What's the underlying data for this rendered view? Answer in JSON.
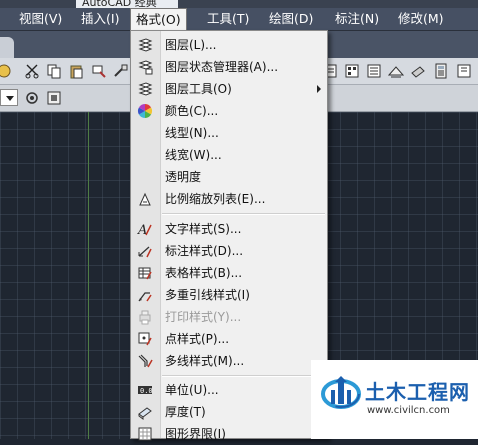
{
  "window": {
    "title_tab": "AutoCAD 经典"
  },
  "menubar": {
    "items": [
      {
        "label": "视图(V)"
      },
      {
        "label": "插入(I)"
      },
      {
        "label": "格式(O)"
      },
      {
        "label": "工具(T)"
      },
      {
        "label": "绘图(D)"
      },
      {
        "label": "标注(N)"
      },
      {
        "label": "修改(M)"
      }
    ]
  },
  "format_menu": {
    "items": [
      {
        "label": "图层(L)...",
        "icon": "layer-icon"
      },
      {
        "label": "图层状态管理器(A)...",
        "icon": "layer-state-icon"
      },
      {
        "label": "图层工具(O)",
        "icon": "layer-tools-icon",
        "submenu": true
      },
      {
        "label": "颜色(C)...",
        "icon": "color-wheel-icon"
      },
      {
        "label": "线型(N)..."
      },
      {
        "label": "线宽(W)..."
      },
      {
        "label": "透明度"
      },
      {
        "label": "比例缩放列表(E)...",
        "icon": "scale-list-icon"
      },
      {
        "label": "文字样式(S)...",
        "icon": "text-style-icon"
      },
      {
        "label": "标注样式(D)...",
        "icon": "dim-style-icon"
      },
      {
        "label": "表格样式(B)...",
        "icon": "table-style-icon"
      },
      {
        "label": "多重引线样式(I)",
        "icon": "mleader-style-icon"
      },
      {
        "label": "打印样式(Y)...",
        "icon": "plot-style-icon",
        "disabled": true
      },
      {
        "label": "点样式(P)...",
        "icon": "point-style-icon"
      },
      {
        "label": "多线样式(M)...",
        "icon": "mline-style-icon"
      },
      {
        "label": "单位(U)...",
        "icon": "units-icon"
      },
      {
        "label": "厚度(T)",
        "icon": "thickness-icon"
      },
      {
        "label": "图形界限(I)",
        "icon": "limits-icon"
      }
    ]
  },
  "watermark": {
    "title": "土木工程网",
    "url": "www.civilcn.com"
  }
}
